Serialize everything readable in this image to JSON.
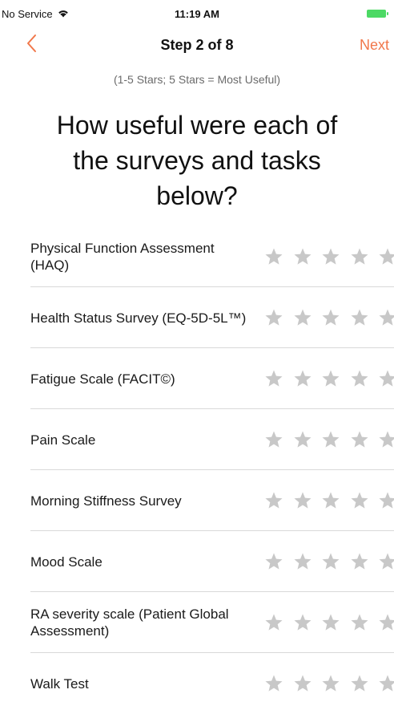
{
  "status_bar": {
    "carrier": "No Service",
    "time": "11:19 AM",
    "icons": [
      "wifi-icon",
      "battery-icon"
    ]
  },
  "nav": {
    "title": "Step 2 of 8",
    "next_label": "Next",
    "back_icon": "chevron-left-icon",
    "accent_color": "#f1774a"
  },
  "subtitle": "(1-5 Stars; 5 Stars = Most Useful)",
  "question": "How useful were each of the surveys and tasks below?",
  "star_color_empty": "#c8c8c8",
  "max_stars": 5,
  "items": [
    {
      "label": "Physical Function Assessment (HAQ)",
      "rating": 0
    },
    {
      "label": "Health Status Survey (EQ-5D-5L™)",
      "rating": 0
    },
    {
      "label": "Fatigue Scale (FACIT©)",
      "rating": 0
    },
    {
      "label": "Pain Scale",
      "rating": 0
    },
    {
      "label": "Morning Stiffness Survey",
      "rating": 0
    },
    {
      "label": "Mood Scale",
      "rating": 0
    },
    {
      "label": "RA severity scale (Patient Global Assessment)",
      "rating": 0
    },
    {
      "label": "Walk Test",
      "rating": 0
    }
  ]
}
